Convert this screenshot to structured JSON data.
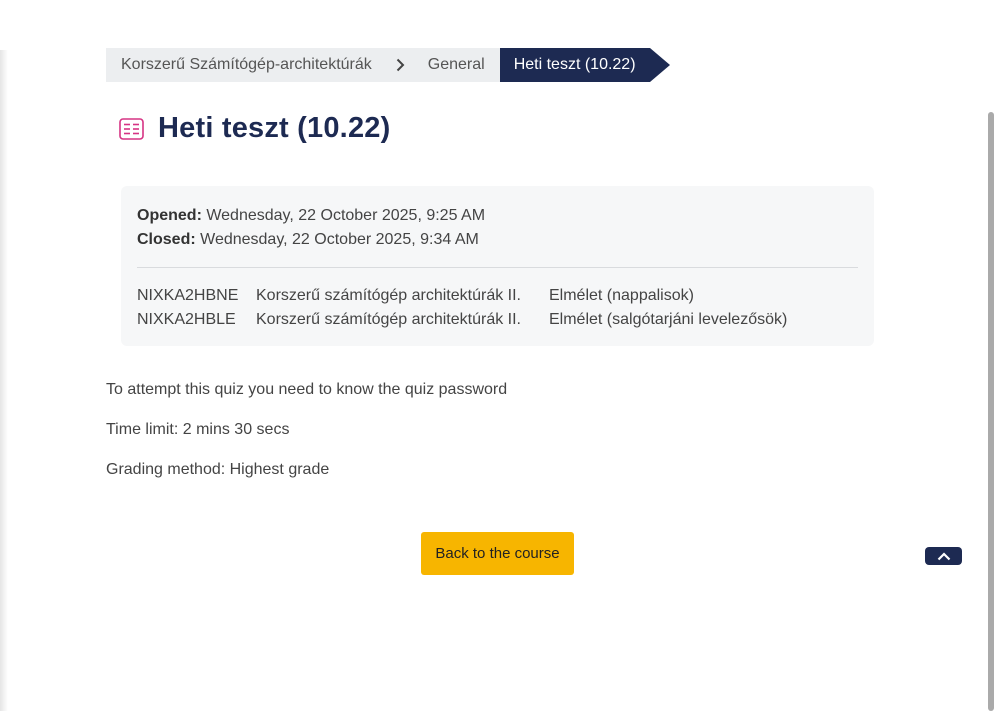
{
  "breadcrumb": {
    "items": [
      {
        "label": "Korszerű Számítógép-architektúrák"
      },
      {
        "label": "General"
      },
      {
        "label": "Heti teszt (10.22)"
      }
    ]
  },
  "page": {
    "title": "Heti teszt (10.22)",
    "icon": "quiz-icon"
  },
  "dates": {
    "opened_label": "Opened:",
    "opened_value": "Wednesday, 22 October 2025, 9:25 AM",
    "closed_label": "Closed:",
    "closed_value": "Wednesday, 22 October 2025, 9:34 AM"
  },
  "groups": [
    {
      "code": "NIXKA2HBNE",
      "course": "Korszerű számítógép architektúrák II.",
      "group": "Elmélet (nappalisok)"
    },
    {
      "code": "NIXKA2HBLE",
      "course": "Korszerű számítógép architektúrák II.",
      "group": "Elmélet (salgótarjáni levelezősök)"
    }
  ],
  "quiz_info": {
    "password_notice": "To attempt this quiz you need to know the quiz password",
    "time_limit": "Time limit: 2 mins 30 secs",
    "grading_method": "Grading method: Highest grade"
  },
  "actions": {
    "back_label": "Back to the course"
  },
  "colors": {
    "brand_navy": "#1d2a52",
    "accent_yellow": "#f7b500",
    "icon_pink": "#d63384"
  }
}
